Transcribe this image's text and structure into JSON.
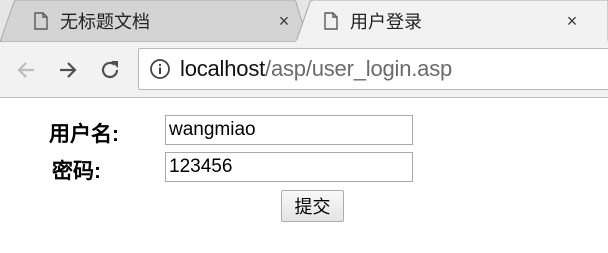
{
  "tabs": [
    {
      "title": "无标题文档",
      "close": "×",
      "active": false
    },
    {
      "title": "用户登录",
      "close": "×",
      "active": true
    }
  ],
  "toolbar": {
    "back_icon": "back-arrow-icon",
    "forward_icon": "forward-arrow-icon",
    "reload_icon": "reload-icon",
    "url_host": "localhost",
    "url_path": "/asp/user_login.asp"
  },
  "form": {
    "username_label": "用户名:",
    "username_value": "wangmiao",
    "password_label": "密码:",
    "password_value": "123456",
    "submit_label": "提交"
  },
  "colors": {
    "tabstrip_bg": "#e6e6e6",
    "active_tab_bg": "#f2f2f2",
    "inactive_tab_bg": "#d4d4d4",
    "toolbar_bg": "#f2f2f2",
    "url_path_color": "#6b6b6b"
  }
}
